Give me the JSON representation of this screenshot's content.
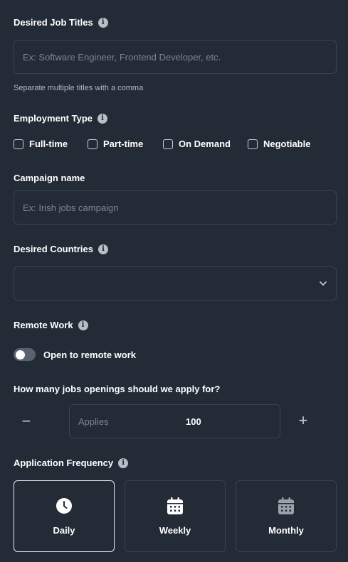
{
  "job_titles": {
    "label": "Desired Job Titles",
    "placeholder": "Ex: Software Engineer, Frontend Developer, etc.",
    "hint": "Separate multiple titles with a comma"
  },
  "employment_type": {
    "label": "Employment Type",
    "options": [
      "Full-time",
      "Part-time",
      "On Demand",
      "Negotiable"
    ]
  },
  "campaign_name": {
    "label": "Campaign name",
    "placeholder": "Ex: Irish jobs campaign"
  },
  "countries": {
    "label": "Desired Countries",
    "value": ""
  },
  "remote_work": {
    "label": "Remote Work",
    "toggle_label": "Open to remote work",
    "enabled": false
  },
  "applies": {
    "question": "How many jobs openings should we apply for?",
    "field_label": "Applies",
    "value": "100",
    "minus": "−",
    "plus": "+"
  },
  "frequency": {
    "label": "Application Frequency",
    "options": [
      {
        "label": "Daily",
        "icon": "clock-icon",
        "selected": true
      },
      {
        "label": "Weekly",
        "icon": "calendar-icon",
        "selected": false
      },
      {
        "label": "Monthly",
        "icon": "calendar-icon",
        "selected": false
      }
    ]
  },
  "colors": {
    "background": "#222b36",
    "border": "#3a4451",
    "selected_border": "#e8ebee"
  }
}
